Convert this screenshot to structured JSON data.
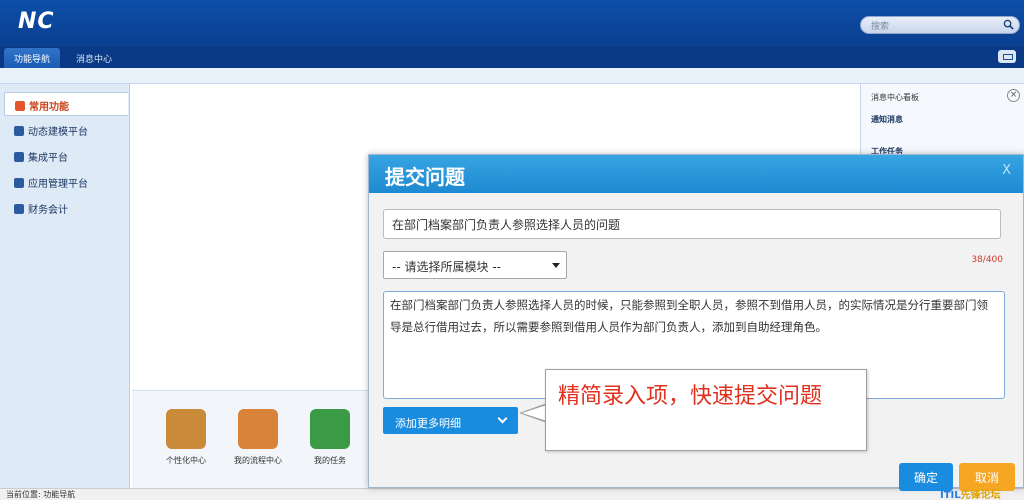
{
  "app": {
    "logo": "NC"
  },
  "search": {
    "placeholder": "搜索"
  },
  "tabs": [
    {
      "label": "功能导航"
    },
    {
      "label": "消息中心"
    }
  ],
  "leftnav": {
    "items": [
      {
        "label": "常用功能",
        "icon": "monitor-icon"
      },
      {
        "label": "动态建模平台",
        "icon": "cube-icon"
      },
      {
        "label": "集成平台",
        "icon": "grid-icon"
      },
      {
        "label": "应用管理平台",
        "icon": "window-icon"
      },
      {
        "label": "财务会计",
        "icon": "book-icon"
      }
    ]
  },
  "dock": {
    "items": [
      {
        "label": "个性化中心",
        "icon": "palette-icon",
        "color": "#c98a3a"
      },
      {
        "label": "我的流程中心",
        "icon": "clipboard-icon",
        "color": "#d9823a"
      },
      {
        "label": "我的任务",
        "icon": "pulse-icon",
        "color": "#3a9a45"
      }
    ]
  },
  "rightpanel": {
    "title": "消息中心看板",
    "items": [
      "通知消息",
      "工作任务"
    ]
  },
  "status": {
    "text": "当前位置: 功能导航"
  },
  "watermark": {
    "part1": "ITIL",
    "part2": "先锋论坛"
  },
  "modal": {
    "title": "提交问题",
    "close": "X",
    "subject_value": "在部门档案部门负责人参照选择人员的问题",
    "module_placeholder": "-- 请选择所属模块 --",
    "counter": "38/400",
    "detail_value": "在部门档案部门负责人参照选择人员的时候，只能参照到全职人员，参照不到借用人员，的实际情况是分行重要部门领导是总行借用过去，所以需要参照到借用人员作为部门负责人，添加到自助经理角色。",
    "add_more_label": "添加更多明细",
    "callout_text": "精简录入项，快速提交问题",
    "ok_label": "确定",
    "cancel_label": "取消"
  },
  "colors": {
    "header": "#0d4fa8",
    "accent": "#1a8ce0",
    "callout": "#e0301e",
    "cancel": "#f5a623"
  }
}
